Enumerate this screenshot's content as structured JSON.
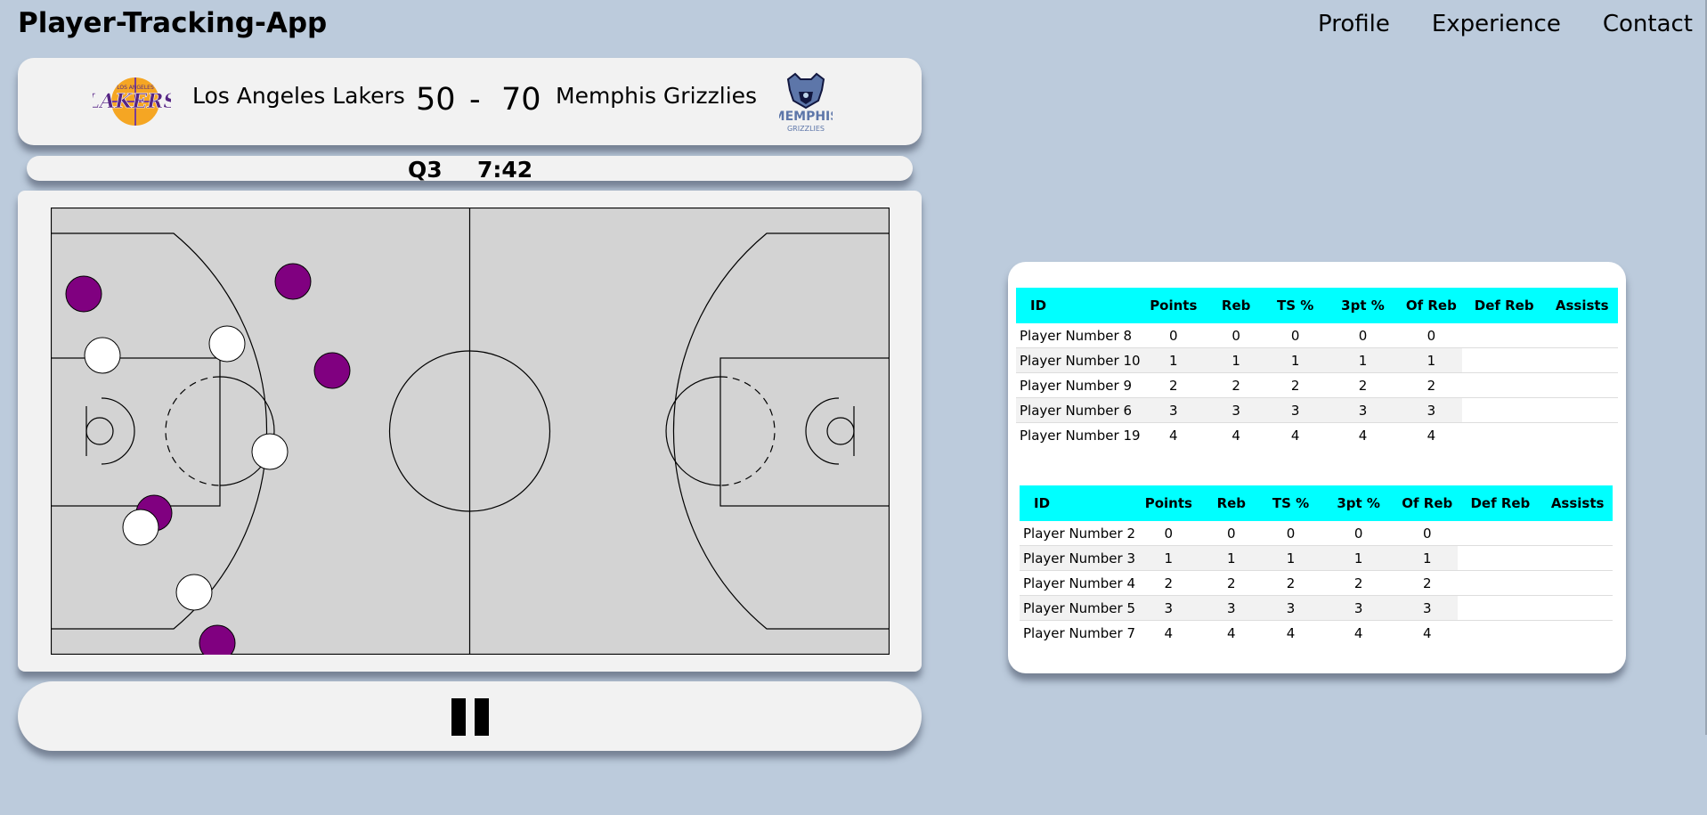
{
  "app": {
    "title": "Player-Tracking-App"
  },
  "nav": [
    {
      "label": "Profile"
    },
    {
      "label": "Experience"
    },
    {
      "label": "Contact"
    }
  ],
  "scoreboard": {
    "home_team": "Los Angeles Lakers",
    "home_score": "50",
    "separator": "-",
    "away_score": "70",
    "away_team": "Memphis Grizzlies",
    "home_logo_icon": "lakers-logo",
    "away_logo_icon": "grizzlies-logo",
    "quarter": "Q3",
    "time": "7:42"
  },
  "colors": {
    "background": "#bccbdc",
    "card": "#f2f2f2",
    "court": "#d3d3d3",
    "home_team_marker": "#800080",
    "away_team_marker": "#ffffff",
    "table_header": "#00ffff"
  },
  "controls": {
    "pause_icon": "pause-icon"
  },
  "stats_tables": [
    {
      "columns": [
        "ID",
        "Points",
        "Reb",
        "TS %",
        "3pt %",
        "Of Reb",
        "Def Reb",
        "Assists"
      ],
      "rows": [
        [
          "Player Number 8",
          "0",
          "0",
          "0",
          "0",
          "0",
          "",
          ""
        ],
        [
          "Player Number 10",
          "1",
          "1",
          "1",
          "1",
          "1",
          "",
          ""
        ],
        [
          "Player Number 9",
          "2",
          "2",
          "2",
          "2",
          "2",
          "",
          ""
        ],
        [
          "Player Number 6",
          "3",
          "3",
          "3",
          "3",
          "3",
          "",
          ""
        ],
        [
          "Player Number 19",
          "4",
          "4",
          "4",
          "4",
          "4",
          "",
          ""
        ]
      ]
    },
    {
      "columns": [
        "ID",
        "Points",
        "Reb",
        "TS %",
        "3pt %",
        "Of Reb",
        "Def Reb",
        "Assists"
      ],
      "rows": [
        [
          "Player Number 2",
          "0",
          "0",
          "0",
          "0",
          "0",
          "",
          ""
        ],
        [
          "Player Number 3",
          "1",
          "1",
          "1",
          "1",
          "1",
          "",
          ""
        ],
        [
          "Player Number 4",
          "2",
          "2",
          "2",
          "2",
          "2",
          "",
          ""
        ],
        [
          "Player Number 5",
          "3",
          "3",
          "3",
          "3",
          "3",
          "",
          ""
        ],
        [
          "Player Number 7",
          "4",
          "4",
          "4",
          "4",
          "4",
          "",
          ""
        ]
      ]
    }
  ]
}
